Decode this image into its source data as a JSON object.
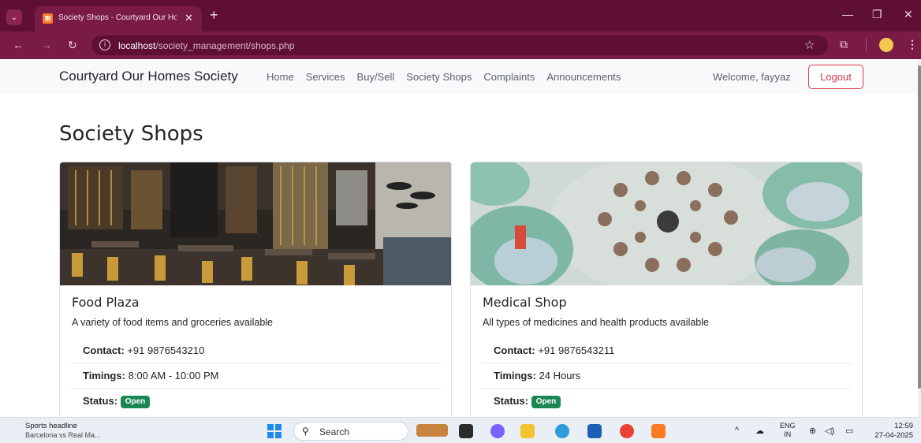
{
  "browser": {
    "tab_title": "Society Shops - Courtyard Our Homes Society",
    "favicon_text": "⊞",
    "url_host": "localhost",
    "url_path": "/society_management/shops.php"
  },
  "navbar": {
    "brand": "Courtyard Our Homes Society",
    "links": [
      "Home",
      "Services",
      "Buy/Sell",
      "Society Shops",
      "Complaints",
      "Announcements"
    ],
    "welcome": "Welcome, fayyaz",
    "logout": "Logout"
  },
  "page": {
    "title": "Society Shops"
  },
  "shops": [
    {
      "name": "Food Plaza",
      "description": "A variety of food items and groceries available",
      "contact_label": "Contact:",
      "contact": "+91 9876543210",
      "timings_label": "Timings:",
      "timings": "8:00 AM - 10:00 PM",
      "status_label": "Status:",
      "status": "Open"
    },
    {
      "name": "Medical Shop",
      "description": "All types of medicines and health products available",
      "contact_label": "Contact:",
      "contact": "+91 9876543211",
      "timings_label": "Timings:",
      "timings": "24 Hours",
      "status_label": "Status:",
      "status": "Open"
    }
  ],
  "taskbar": {
    "news_title": "Sports headline",
    "news_text": "Barcelona vs Real Ma...",
    "search": "Search",
    "lang_top": "ENG",
    "lang_bottom": "IN",
    "time": "12:59",
    "date": "27-04-2025"
  },
  "colors": {
    "browser_frame": "#7a1a47",
    "badge_open": "#198754",
    "logout": "#dc3545"
  }
}
